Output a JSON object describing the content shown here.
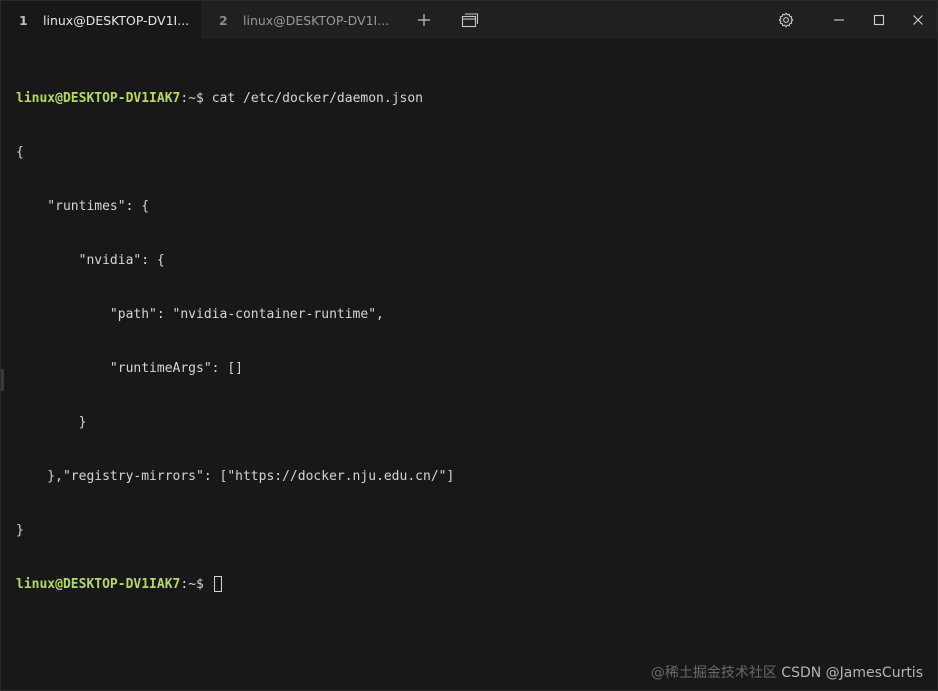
{
  "tabs": [
    {
      "number": "1",
      "title": "linux@DESKTOP-DV1I..."
    },
    {
      "number": "2",
      "title": "linux@DESKTOP-DV1I..."
    }
  ],
  "toolbar": {
    "new_tab_icon": "plus-icon",
    "dropdown_icon": "window-stack-icon",
    "settings_icon": "gear-icon",
    "minimize_icon": "minimize-icon",
    "maximize_icon": "maximize-icon",
    "close_icon": "close-icon"
  },
  "terminal": {
    "prompt_user": "linux@DESKTOP-DV1IAK7",
    "prompt_path": ":~$ ",
    "command": "cat /etc/docker/daemon.json",
    "output": [
      "{",
      "    \"runtimes\": {",
      "        \"nvidia\": {",
      "            \"path\": \"nvidia-container-runtime\",",
      "            \"runtimeArgs\": []",
      "        }",
      "    },\"registry-mirrors\": [\"https://docker.nju.edu.cn/\"]",
      "}"
    ],
    "prompt_user_2": "linux@DESKTOP-DV1IAK7",
    "prompt_path_2": ":~$ "
  },
  "watermark": {
    "faint": "@稀土掘金技术社区",
    "text": "CSDN @JamesCurtis"
  },
  "colors": {
    "background": "#181818",
    "titlebar": "#202020",
    "prompt_green": "#b5d86d",
    "text": "#d6d6d6"
  }
}
